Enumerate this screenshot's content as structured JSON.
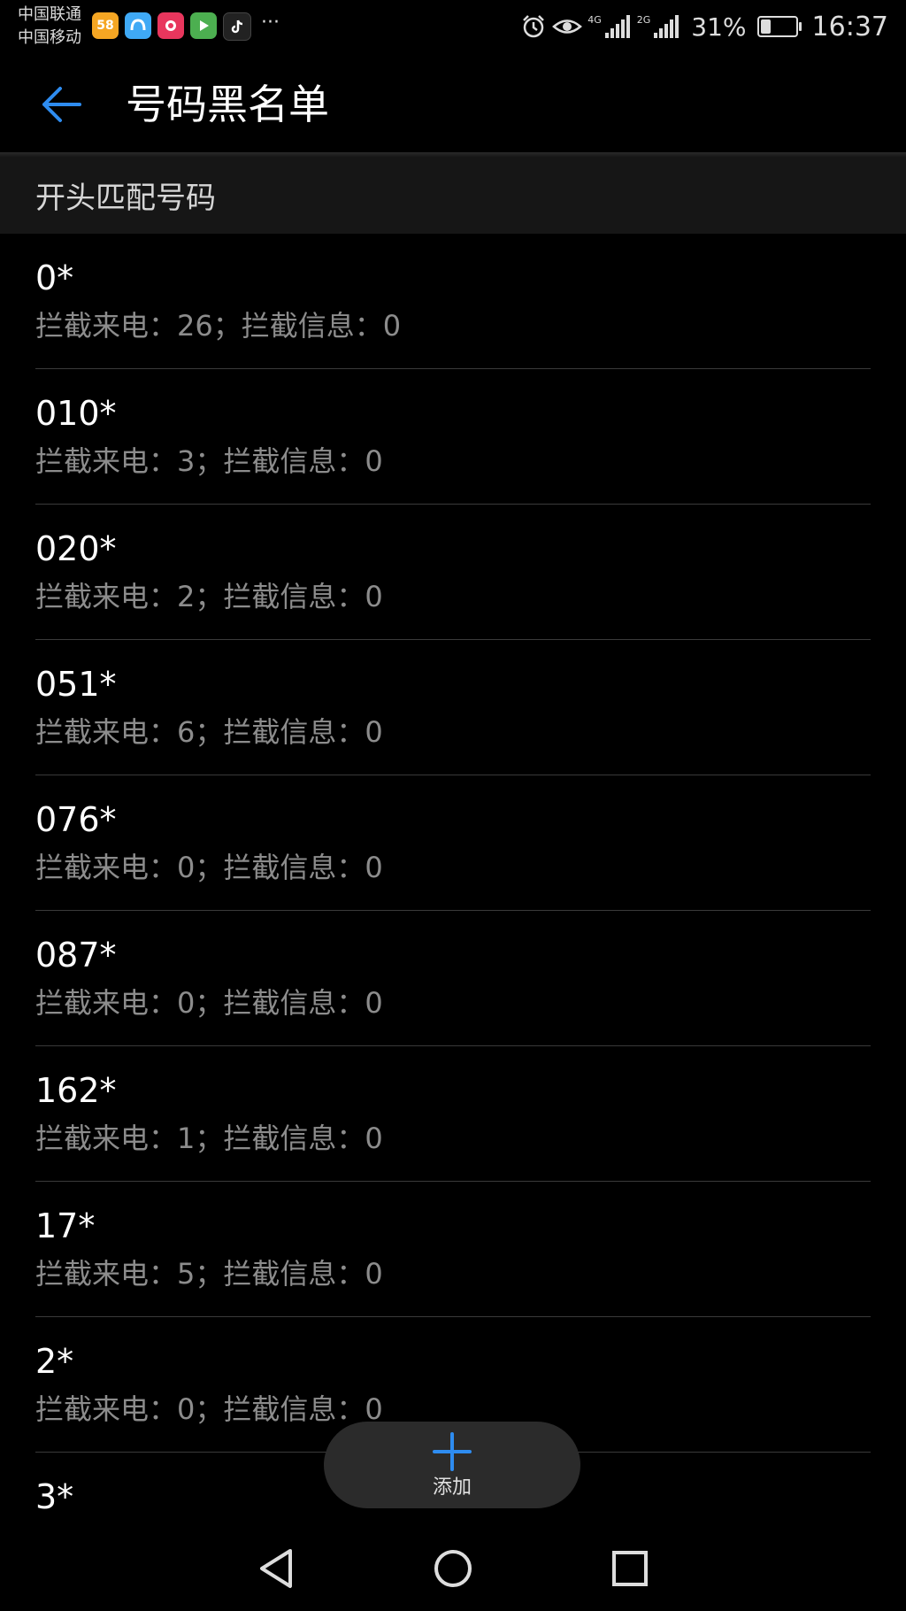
{
  "status_bar": {
    "carrier_1": "中国联通",
    "carrier_2": "中国移动",
    "app_badges": [
      {
        "name": "58",
        "color": "#f5a623"
      },
      {
        "name": "",
        "color": "#3fa9f5"
      },
      {
        "name": "",
        "color": "#e8365d"
      },
      {
        "name": "",
        "color": "#4caf50"
      },
      {
        "name": "",
        "color": "#222222"
      }
    ],
    "more": "···",
    "network_1": "4G",
    "network_2": "2G",
    "battery": "31%",
    "battery_level": 0.31,
    "time": "16:37"
  },
  "app_bar": {
    "title": "号码黑名单",
    "accent_color": "#2e8cf0"
  },
  "section": {
    "title": "开头匹配号码"
  },
  "items": [
    {
      "number": "0*",
      "stats": "拦截来电：26；拦截信息：0"
    },
    {
      "number": "010*",
      "stats": "拦截来电：3；拦截信息：0"
    },
    {
      "number": "020*",
      "stats": "拦截来电：2；拦截信息：0"
    },
    {
      "number": "051*",
      "stats": "拦截来电：6；拦截信息：0"
    },
    {
      "number": "076*",
      "stats": "拦截来电：0；拦截信息：0"
    },
    {
      "number": "087*",
      "stats": "拦截来电：0；拦截信息：0"
    },
    {
      "number": "162*",
      "stats": "拦截来电：1；拦截信息：0"
    },
    {
      "number": "17*",
      "stats": "拦截来电：5；拦截信息：0"
    },
    {
      "number": "2*",
      "stats": "拦截来电：0；拦截信息：0"
    },
    {
      "number": "3*",
      "stats": ""
    }
  ],
  "fab": {
    "label": "添加"
  }
}
